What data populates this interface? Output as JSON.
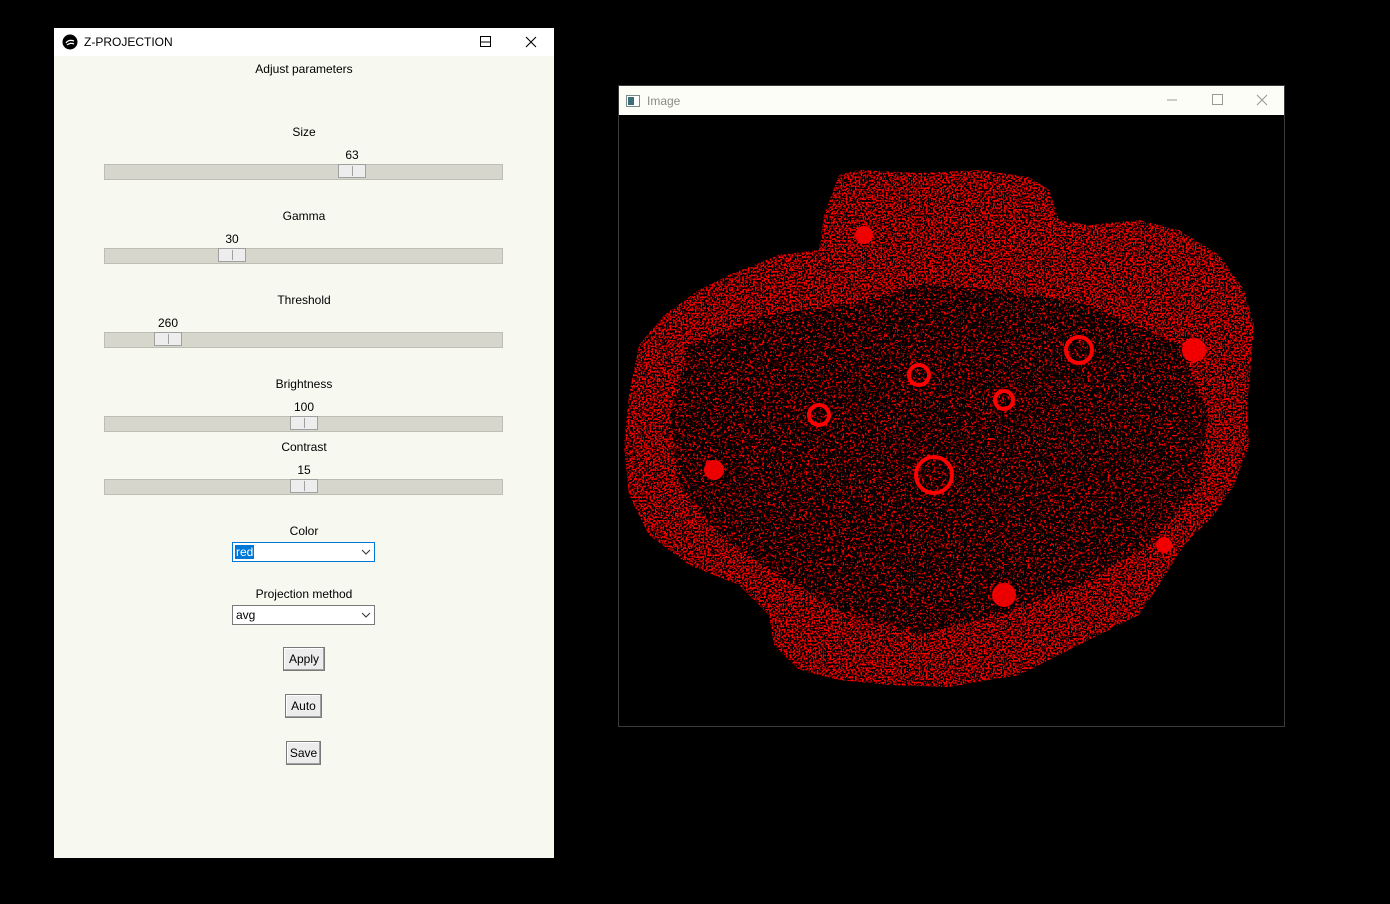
{
  "zprojection_window": {
    "title": "Z-PROJECTION",
    "heading": "Adjust parameters",
    "sliders": [
      {
        "label": "Size",
        "value": "63"
      },
      {
        "label": "Gamma",
        "value": "30"
      },
      {
        "label": "Threshold",
        "value": "260"
      },
      {
        "label": "Brightness",
        "value": "100"
      },
      {
        "label": "Contrast",
        "value": "15"
      }
    ],
    "color": {
      "label": "Color",
      "selected": "red"
    },
    "projection": {
      "label": "Projection method",
      "selected": "avg"
    },
    "buttons": {
      "apply": "Apply",
      "auto": "Auto",
      "save": "Save"
    }
  },
  "image_window": {
    "title": "Image",
    "display_color": "#ff0000"
  }
}
